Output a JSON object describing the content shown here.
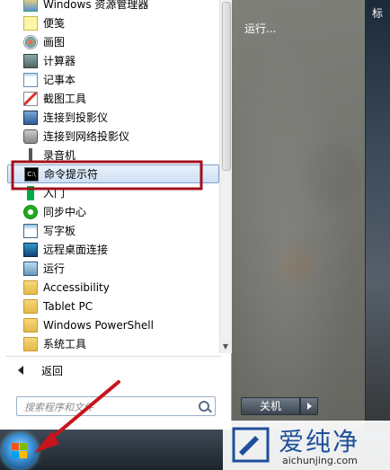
{
  "desktop": {
    "strip_label": "标"
  },
  "programs": [
    {
      "label": "Windows 资源管理器",
      "icon": "explorer-icon"
    },
    {
      "label": "便笺",
      "icon": "sticky-notes-icon"
    },
    {
      "label": "画图",
      "icon": "paint-icon"
    },
    {
      "label": "计算器",
      "icon": "calculator-icon"
    },
    {
      "label": "记事本",
      "icon": "notepad-icon"
    },
    {
      "label": "截图工具",
      "icon": "snipping-tool-icon"
    },
    {
      "label": "连接到投影仪",
      "icon": "projector-icon"
    },
    {
      "label": "连接到网络投影仪",
      "icon": "network-projector-icon"
    },
    {
      "label": "录音机",
      "icon": "microphone-icon"
    },
    {
      "label": "命令提示符",
      "icon": "cmd-icon"
    },
    {
      "label": "入门",
      "icon": "getting-started-icon"
    },
    {
      "label": "同步中心",
      "icon": "sync-center-icon"
    },
    {
      "label": "写字板",
      "icon": "wordpad-icon"
    },
    {
      "label": "远程桌面连接",
      "icon": "remote-desktop-icon"
    },
    {
      "label": "运行",
      "icon": "run-icon"
    },
    {
      "label": "Accessibility",
      "icon": "folder-icon"
    },
    {
      "label": "Tablet PC",
      "icon": "folder-icon"
    },
    {
      "label": "Windows PowerShell",
      "icon": "folder-icon"
    },
    {
      "label": "系统工具",
      "icon": "folder-icon"
    }
  ],
  "highlighted_index": 9,
  "back_label": "返回",
  "search": {
    "placeholder": "搜索程序和文件"
  },
  "right_pane": {
    "run_label": "运行...",
    "shutdown_label": "关机"
  },
  "cmd_icon_text": "C:\\",
  "watermark": {
    "brand": "爱纯净",
    "url": "aichunjing.com"
  },
  "colors": {
    "highlight_box": "#a3101c",
    "annotation_arrow": "#c8141c",
    "watermark_blue": "#1f4f9a"
  }
}
